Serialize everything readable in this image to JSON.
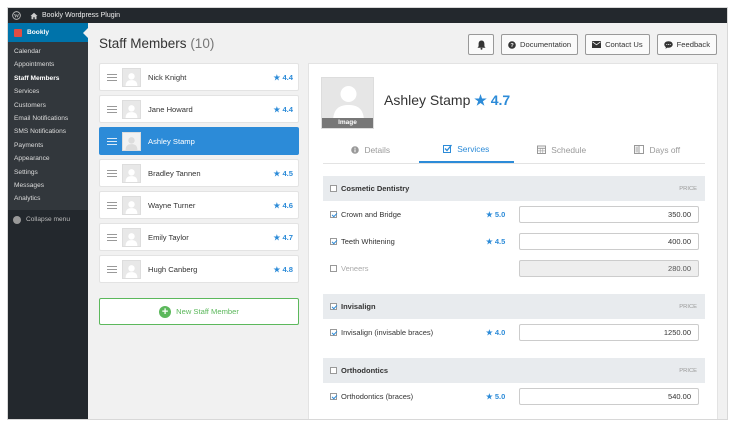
{
  "adminbar": {
    "site_title": "Bookly Wordpress Plugin"
  },
  "sidebar": {
    "brand": "Bookly",
    "items": [
      {
        "label": "Calendar",
        "active": false
      },
      {
        "label": "Appointments",
        "active": false
      },
      {
        "label": "Staff Members",
        "active": true
      },
      {
        "label": "Services",
        "active": false
      },
      {
        "label": "Customers",
        "active": false
      },
      {
        "label": "Email Notifications",
        "active": false
      },
      {
        "label": "SMS Notifications",
        "active": false
      },
      {
        "label": "Payments",
        "active": false
      },
      {
        "label": "Appearance",
        "active": false
      },
      {
        "label": "Settings",
        "active": false
      },
      {
        "label": "Messages",
        "active": false
      },
      {
        "label": "Analytics",
        "active": false
      }
    ],
    "collapse_label": "Collapse menu"
  },
  "header": {
    "title": "Staff Members",
    "count": "(10)",
    "documentation": "Documentation",
    "contact_us": "Contact Us",
    "feedback": "Feedback"
  },
  "staff": [
    {
      "name": "Nick Knight",
      "rating": "4.4"
    },
    {
      "name": "Jane Howard",
      "rating": "4.4"
    },
    {
      "name": "Ashley Stamp",
      "rating": ""
    },
    {
      "name": "Bradley Tannen",
      "rating": "4.5"
    },
    {
      "name": "Wayne Turner",
      "rating": "4.6"
    },
    {
      "name": "Emily Taylor",
      "rating": "4.7"
    },
    {
      "name": "Hugh Canberg",
      "rating": "4.8"
    }
  ],
  "add_staff": "New Staff Member",
  "detail": {
    "photo_label": "Image",
    "name": "Ashley Stamp",
    "rating": "4.7",
    "tabs": [
      {
        "label": "Details",
        "icon": "info-icon"
      },
      {
        "label": "Services",
        "icon": "checkbox-icon",
        "active": true
      },
      {
        "label": "Schedule",
        "icon": "calendar-icon"
      },
      {
        "label": "Days off",
        "icon": "book-icon"
      }
    ]
  },
  "services": {
    "price_header": "PRICE",
    "groups": [
      {
        "name": "Cosmetic Dentistry",
        "checked": false,
        "items": [
          {
            "name": "Crown and Bridge",
            "checked": true,
            "rating": "5.0",
            "price": "350.00"
          },
          {
            "name": "Teeth Whitening",
            "checked": true,
            "rating": "4.5",
            "price": "400.00"
          },
          {
            "name": "Veneers",
            "checked": false,
            "rating": "",
            "price": "280.00"
          }
        ]
      },
      {
        "name": "Invisalign",
        "checked": true,
        "items": [
          {
            "name": "Invisalign (invisable braces)",
            "checked": true,
            "rating": "4.0",
            "price": "1250.00"
          }
        ]
      },
      {
        "name": "Orthodontics",
        "checked": false,
        "items": [
          {
            "name": "Orthodontics (braces)",
            "checked": true,
            "rating": "5.0",
            "price": "540.00"
          }
        ]
      }
    ]
  },
  "colors": {
    "accent": "#2c8bd8",
    "wp_dark": "#23282d",
    "wp_blue": "#0073aa",
    "success": "#5cb85c"
  }
}
